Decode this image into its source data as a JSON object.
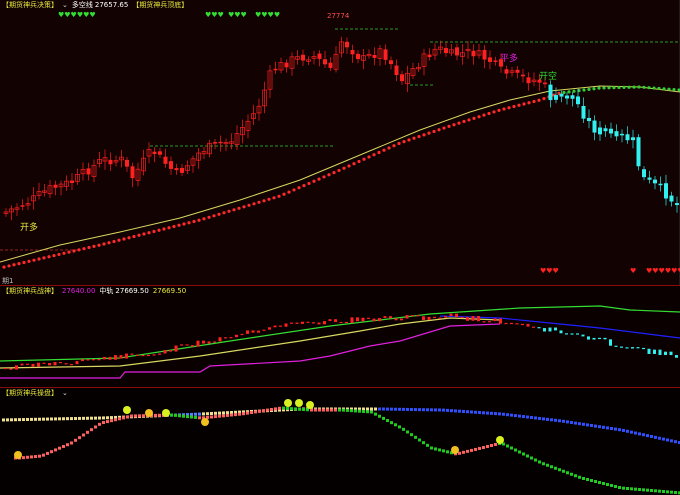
{
  "panel1": {
    "indicator_name": "【期货神兵决策】",
    "chevron": "⌄",
    "line_label": "多空线",
    "line_value": "27657.65",
    "indicator_name2": "【期货神兵顶底】",
    "peak_label": "27774",
    "signals": {
      "open_long": "开多",
      "close_long": "平多",
      "open_short": "开空"
    },
    "corner_text": "期1",
    "top_hearts": [
      "♥♥♥♥♥♥",
      "♥♥♥",
      "♥♥♥",
      "♥♥♥♥"
    ],
    "bottom_hearts": [
      "♥♥♥",
      "♥",
      "♥♥♥♥♥♥"
    ]
  },
  "panel2": {
    "indicator_name": "【期货神兵战神】",
    "value1": "27640.00",
    "mid_label": "中轨",
    "mid_value": "27669.50",
    "value3": "27669.50"
  },
  "panel3": {
    "indicator_name": "【期货神兵操盘】",
    "chevron": "⌄"
  },
  "colors": {
    "up": "#ff2020",
    "down": "#30f0f0",
    "ma_yellow": "#d8d860",
    "dots_red": "#ff2a2a",
    "dots_green": "#33cc33",
    "green_line": "#33dd33",
    "blue_line": "#2020ff",
    "magenta_line": "#e020e0",
    "text_yellow": "#e8e840",
    "text_white": "#ffffff",
    "text_magenta": "#e020e0"
  }
}
